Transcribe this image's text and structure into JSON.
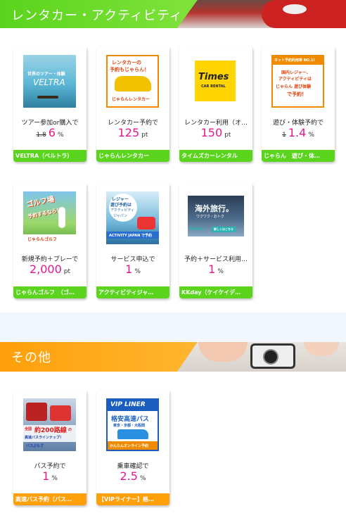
{
  "sections": {
    "rental": {
      "title": "レンタカー・アクティビティ"
    },
    "other": {
      "title": "その他"
    }
  },
  "cards": {
    "veltra": {
      "banner": {
        "text1": "世界のツアー・体験",
        "logo": "VELTRA"
      },
      "desc": "ツアー参加or購入で",
      "old_rate": "1.8",
      "rate": "6",
      "unit": "%",
      "shop": "VELTRA（ベルトラ）"
    },
    "jalan_rentacar": {
      "banner": {
        "text1": "レンタカーの",
        "text2": "予約もじゃらん！",
        "logo": "じゃらんレンタカー"
      },
      "desc": "レンタカー予約で",
      "rate": "125",
      "unit": "pt",
      "shop": "じゃらんレンタカー"
    },
    "times": {
      "banner": {
        "logo": "Times",
        "sub": "CAR RENTAL"
      },
      "desc": "レンタカー利用（オ…",
      "rate": "150",
      "unit": "pt",
      "shop": "タイムズカーレンタル"
    },
    "jalan_asobi": {
      "banner": {
        "text0": "ネット予約利用率 NO.1!",
        "text1": "国内レジャー、",
        "text2": "アクティビティは",
        "text3": "じゃらん 遊び体験",
        "text4": "で予約！"
      },
      "desc": "遊び・体験予約で",
      "old_rate": "1",
      "rate": "1.4",
      "unit": "%",
      "shop": "じゃらん　遊び・体…"
    },
    "jalan_golf": {
      "banner": {
        "text1": "ゴルフ場",
        "text2": "予約するなら！",
        "logo": "じゃらんゴルフ"
      },
      "desc": "新規予約＋プレーで",
      "rate": "2,000",
      "unit": "pt",
      "shop": "じゃらんゴルフ　（ゴ…"
    },
    "activity_japan": {
      "banner": {
        "text1": "レジャー",
        "text2": "遊び予約は",
        "text3": "アクティビティ",
        "text4": "ジャパン",
        "logo": "ACTIVITY JAPAN で予約"
      },
      "desc": "サービス申込で",
      "rate": "1",
      "unit": "%",
      "shop": "アクティビティジャ…"
    },
    "kkday": {
      "banner": {
        "text1": "海外旅行。",
        "text2": "ワクワク・おトク",
        "logo": "kkday",
        "btn": "詳しくはこちら"
      },
      "desc": "予約＋サービス利用…",
      "rate": "1",
      "unit": "%",
      "shop": "KKday（ケイケイデ…"
    },
    "kosoku_bus": {
      "banner": {
        "text1": "全国",
        "text2": "約200路線",
        "text3": "の",
        "text4": "高速バスラインナップ！",
        "logo": "バスぷらざ"
      },
      "desc": "バス予約で",
      "rate": "1",
      "unit": "%",
      "shop": "高速バス予約（バス…"
    },
    "vip_liner": {
      "banner": {
        "logo": "VIP LINER",
        "text1": "格安高速バス",
        "text2": "東京・京都・大阪間",
        "text3": "かんたんオンライン予約"
      },
      "desc": "乗車確認で",
      "rate": "2.5",
      "unit": "%",
      "shop": "【VIPライナー】格…"
    }
  },
  "colors": {
    "green": "#5ad41d",
    "orange": "#ff9f0a",
    "pink": "#e6198a"
  }
}
